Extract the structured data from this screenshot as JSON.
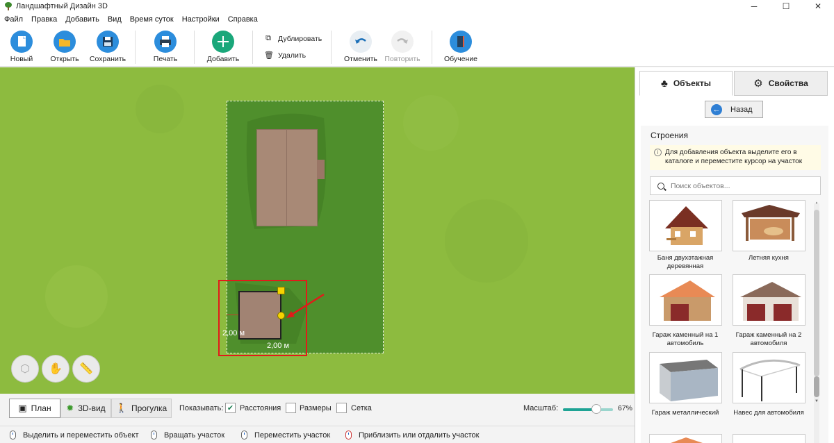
{
  "window": {
    "title": "Ландшафтный Дизайн 3D",
    "minimize": "─",
    "maximize": "☐",
    "close": "✕"
  },
  "menu": [
    "Файл",
    "Правка",
    "Добавить",
    "Вид",
    "Время суток",
    "Настройки",
    "Справка"
  ],
  "toolbar": {
    "new": "Новый",
    "open": "Открыть",
    "save": "Сохранить",
    "print": "Печать",
    "add": "Добавить",
    "duplicate": "Дублировать",
    "delete": "Удалить",
    "undo": "Отменить",
    "redo": "Повторить",
    "tutorial": "Обучение"
  },
  "canvas": {
    "dim_left": "2,00 м",
    "dim_bottom": "2,00 м"
  },
  "views": {
    "plan": "План",
    "view3d": "3D-вид",
    "walk": "Прогулка"
  },
  "show": {
    "label": "Показывать:",
    "distances": "Расстояния",
    "distances_checked": true,
    "sizes": "Размеры",
    "sizes_checked": false,
    "grid": "Сетка",
    "grid_checked": false
  },
  "scale": {
    "label": "Масштаб:",
    "value": "67%",
    "fraction": 0.67
  },
  "status": [
    "Выделить и переместить объект",
    "Вращать участок",
    "Переместить участок",
    "Приблизить или отдалить участок"
  ],
  "panel": {
    "tab_objects": "Объекты",
    "tab_properties": "Свойства",
    "back": "Назад",
    "section": "Строения",
    "info": "Для добавления объекта выделите его в каталоге и переместите курсор на участок",
    "search_placeholder": "Поиск объектов...",
    "items": [
      {
        "name": "Баня двухэтажная деревянная"
      },
      {
        "name": "Летняя кухня"
      },
      {
        "name": "Гараж каменный на 1 автомобиль"
      },
      {
        "name": "Гараж каменный на 2 автомобиля"
      },
      {
        "name": "Гараж металлический"
      },
      {
        "name": "Навес для автомобиля"
      }
    ]
  },
  "colors": {
    "grass": "#8dbb3f",
    "plot": "#4f8f2c",
    "highlight": "#e21a1a",
    "accent": "#1ea394"
  }
}
